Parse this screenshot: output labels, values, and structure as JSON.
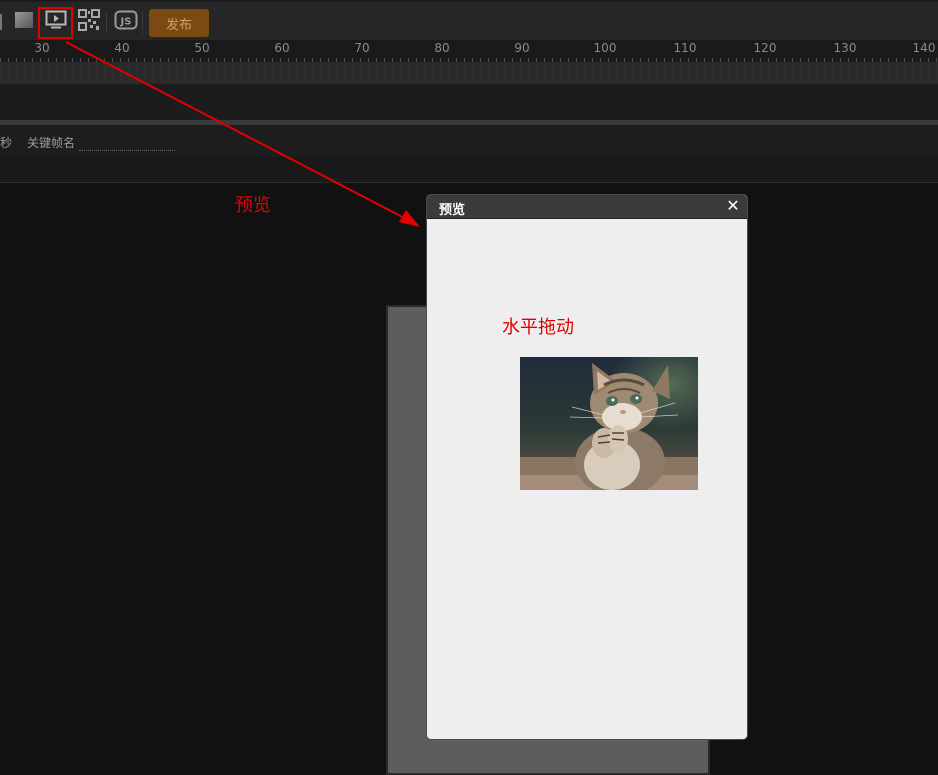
{
  "toolbar": {
    "icons": [
      "square-icon",
      "preview-play-icon",
      "qrcode-icon",
      "js-icon"
    ],
    "publish_label": "发布",
    "colors": {
      "publish_bg": "#7a4a12",
      "highlight": "#e00000"
    }
  },
  "ruler": {
    "ticks": [
      "30",
      "40",
      "50",
      "60",
      "70",
      "80",
      "90",
      "100",
      "110",
      "120",
      "130",
      "140"
    ]
  },
  "keyframe": {
    "seconds_label": "秒",
    "name_label": "关键帧名",
    "name_value": ""
  },
  "annotations": {
    "preview_label": "预览",
    "drag_label": "水平拖动"
  },
  "preview_dialog": {
    "title": "预览",
    "close_glyph": "✕",
    "image_subject": "kitten"
  }
}
